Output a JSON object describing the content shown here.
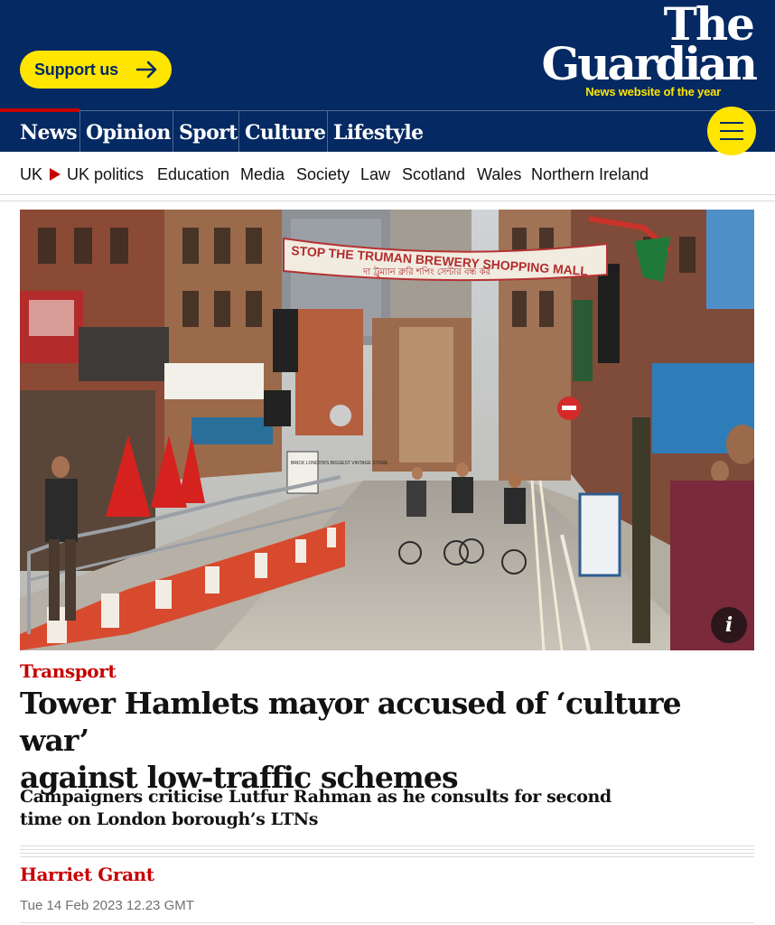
{
  "header": {
    "support_label": "Support us",
    "logo_line1": "The",
    "logo_line2": "Guardian",
    "logo_tagline": "News website of the year",
    "colors": {
      "brand_blue": "#052962",
      "accent_yellow": "#ffe500",
      "news_red": "#c70000"
    }
  },
  "pillars": [
    "News",
    "Opinion",
    "Sport",
    "Culture",
    "Lifestyle"
  ],
  "menu_icon": "hamburger-icon",
  "subnav": [
    "UK",
    "UK politics",
    "Education",
    "Media",
    "Society",
    "Law",
    "Scotland",
    "Wales",
    "Northern Ireland"
  ],
  "hero": {
    "banner_line1": "STOP THE TRUMAN BREWERY SHOPPING MALL",
    "banner_line2": "দা ট্রুম্যান ব্রুরি শপিং সেন্টার বন্ধ কর",
    "shop_sign": "BRICK LONDON'S BIGGEST VINTAGE STORE",
    "info_icon": "info-icon",
    "info_label": "i"
  },
  "article": {
    "kicker": "Transport",
    "headline_line1": "Tower Hamlets mayor accused of ‘culture war’",
    "headline_line2": "against low-traffic schemes",
    "standfirst_line1": "Campaigners criticise Lutfur Rahman as he consults for second",
    "standfirst_line2": "time on London borough’s LTNs",
    "byline": "Harriet Grant",
    "dateline": "Tue 14 Feb 2023 12.23 GMT"
  }
}
